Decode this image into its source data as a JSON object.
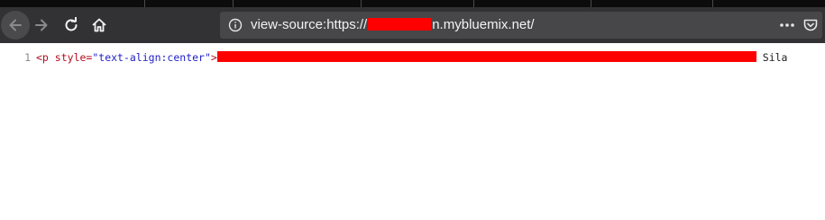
{
  "toolbar": {
    "back_icon": "back-arrow-icon",
    "forward_icon": "forward-arrow-icon",
    "reload_icon": "reload-icon",
    "home_icon": "home-icon",
    "url": {
      "prefix": "view-source:https://",
      "suffix": "n.mybluemix.net/"
    },
    "site_info_icon": "info-circle-icon",
    "page_actions_icon": "more-dots-icon",
    "pocket_icon": "pocket-icon"
  },
  "source": {
    "line_number": "1",
    "open_tag": "<p",
    "attr_name": "style=",
    "attr_value": "\"text-align:center\"",
    "tag_close": ">",
    "trailing_text": " Sila"
  },
  "colors": {
    "redaction": "#ff0000",
    "tag": "#b5091e",
    "attr_value": "#1e1ec8"
  }
}
